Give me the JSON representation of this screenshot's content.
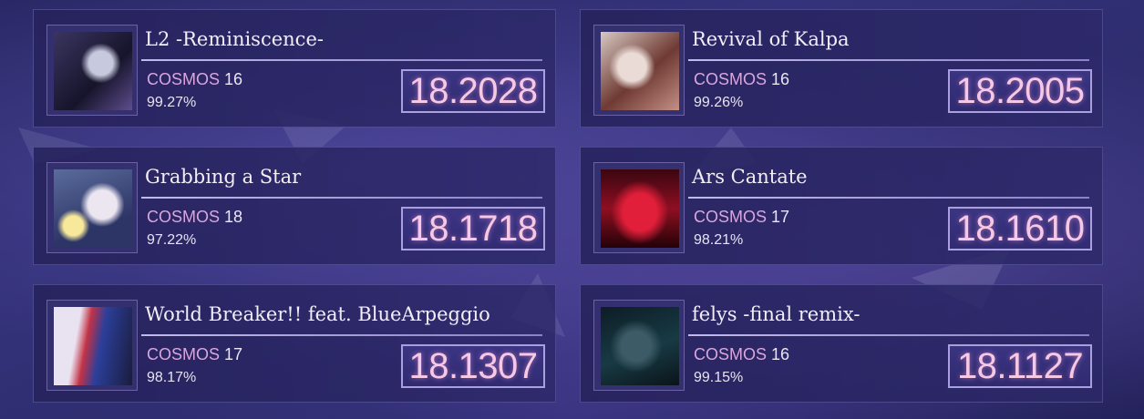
{
  "cards": [
    {
      "title": "L2 -Reminiscence-",
      "difficulty": "COSMOS",
      "level": "16",
      "accuracy": "99.27%",
      "rating": "18.2028"
    },
    {
      "title": "Revival of Kalpa",
      "difficulty": "COSMOS",
      "level": "16",
      "accuracy": "99.26%",
      "rating": "18.2005"
    },
    {
      "title": "Grabbing a Star",
      "difficulty": "COSMOS",
      "level": "18",
      "accuracy": "97.22%",
      "rating": "18.1718"
    },
    {
      "title": "Ars Cantate",
      "difficulty": "COSMOS",
      "level": "17",
      "accuracy": "98.21%",
      "rating": "18.1610"
    },
    {
      "title": "World Breaker!! feat. BlueArpeggio",
      "difficulty": "COSMOS",
      "level": "17",
      "accuracy": "98.17%",
      "rating": "18.1307"
    },
    {
      "title": "felys -final remix-",
      "difficulty": "COSMOS",
      "level": "16",
      "accuracy": "99.15%",
      "rating": "18.1127"
    }
  ],
  "colors": {
    "difficulty_cosmos": "#d9a6dd",
    "rating_text": "#f6c8e4",
    "background": "#2a2866"
  }
}
